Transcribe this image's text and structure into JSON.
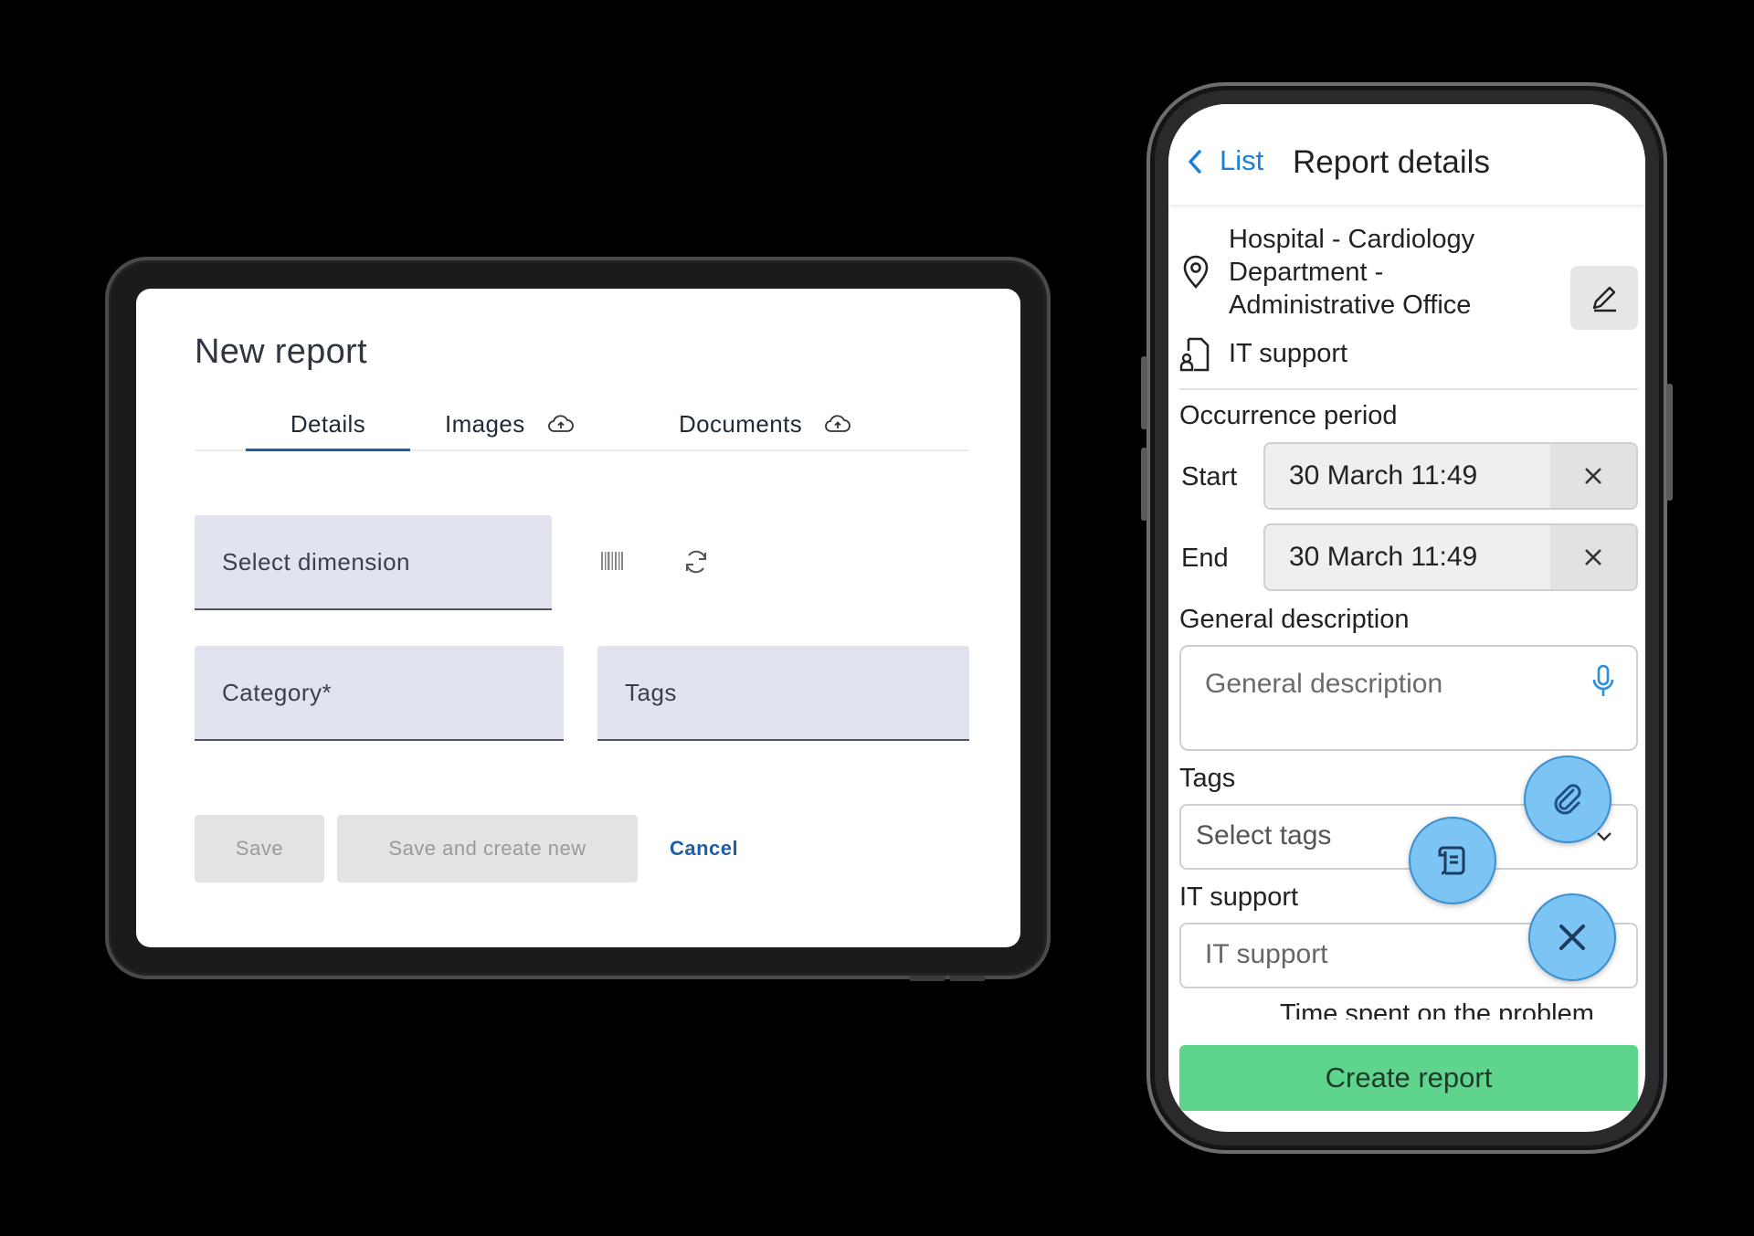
{
  "tablet": {
    "title": "New report",
    "tabs": [
      {
        "label": "Details",
        "active": true
      },
      {
        "label": "Images",
        "icon": "cloud-upload-icon"
      },
      {
        "label": "Documents",
        "icon": "cloud-upload-icon"
      }
    ],
    "fields": {
      "dimension_placeholder": "Select dimension",
      "category_placeholder": "Category*",
      "tags_placeholder": "Tags"
    },
    "icons": {
      "barcode": "barcode-icon",
      "refresh": "refresh-icon"
    },
    "buttons": {
      "save": "Save",
      "save_and_new": "Save and create new",
      "cancel": "Cancel"
    },
    "colors": {
      "accent": "#1d5fa8",
      "field_bg": "#e1e4ee"
    }
  },
  "phone": {
    "back_label": "List",
    "title": "Report details",
    "location": "Hospital - Cardiology Department - Administrative Office",
    "service": "IT support",
    "occurrence_label": "Occurrence period",
    "start_label": "Start",
    "start_value": "30 March 11:49",
    "end_label": "End",
    "end_value": "30 March 11:49",
    "general_description_label": "General description",
    "general_description_placeholder": "General description",
    "tags_label": "Tags",
    "tags_placeholder": "Select tags",
    "it_support_label": "IT support",
    "it_support_placeholder": "IT support",
    "time_spent_label": "Time spent on the problem",
    "create_button": "Create report",
    "colors": {
      "link": "#1a7fd6",
      "create": "#5fd48c",
      "fab": "#7cc4f3"
    }
  }
}
